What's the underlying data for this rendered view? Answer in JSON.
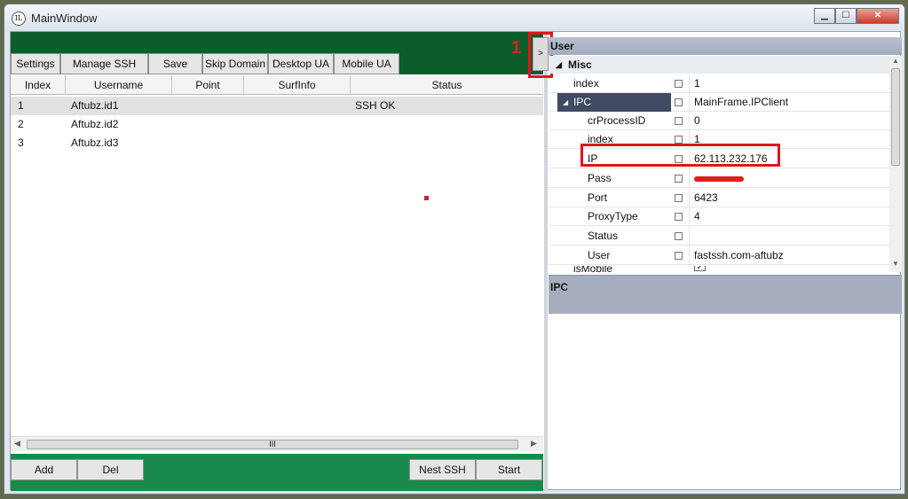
{
  "window": {
    "title": "MainWindow",
    "icon_name": "app-logo-icon",
    "controls": {
      "minimize": "▁",
      "maximize": "☐",
      "close": "✕"
    }
  },
  "toolbar": {
    "buttons": [
      "Settings",
      "Manage SSH",
      "Save",
      "Skip Domain",
      "Desktop UA",
      "Mobile UA"
    ],
    "band_color": "#0b5e2b"
  },
  "grid": {
    "columns": [
      "Index",
      "Username",
      "Point",
      "SurfInfo",
      "Status"
    ],
    "rows": [
      {
        "index": "1",
        "username": "Aftubz.id1",
        "point": "",
        "surfinfo": "",
        "status": "SSH OK"
      },
      {
        "index": "2",
        "username": "Aftubz.id2",
        "point": "",
        "surfinfo": "",
        "status": ""
      },
      {
        "index": "3",
        "username": "Aftubz.id3",
        "point": "",
        "surfinfo": "",
        "status": ""
      }
    ],
    "scroll_thumb": "III"
  },
  "bottom": {
    "buttons": [
      "Add",
      "Del",
      "Nest SSH",
      "Start"
    ],
    "band_color": "#1a8a4c"
  },
  "annotation": {
    "label": "1",
    "color": "#e1141c"
  },
  "expander": {
    "label": ">"
  },
  "property_grid": {
    "header": "User",
    "category": "Misc",
    "rows": [
      {
        "label": "index",
        "value": "1",
        "level": 1
      },
      {
        "label": "IPC",
        "value": "MainFrame.IPClient",
        "level": 1,
        "expanded": true,
        "selected": true
      },
      {
        "label": "crProcessID",
        "value": "0",
        "level": 2
      },
      {
        "label": "index",
        "value": "1",
        "level": 2
      },
      {
        "label": "IP",
        "value": "62.113.232.176",
        "level": 2,
        "highlighted": true
      },
      {
        "label": "Pass",
        "value": "",
        "level": 2,
        "redacted": true
      },
      {
        "label": "Port",
        "value": "6423",
        "level": 2
      },
      {
        "label": "ProxyType",
        "value": "4",
        "level": 2
      },
      {
        "label": "Status",
        "value": "",
        "level": 2
      },
      {
        "label": "User",
        "value": "fastssh.com-aftubz",
        "level": 2
      },
      {
        "label": "isMobile",
        "value": "",
        "level": 1,
        "checkbox": true
      }
    ],
    "description": "IPC",
    "selected_color": "#3f4a63"
  }
}
